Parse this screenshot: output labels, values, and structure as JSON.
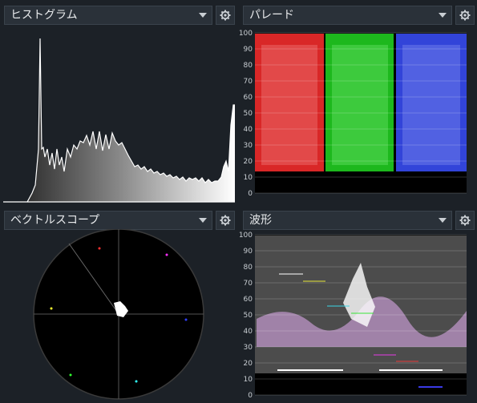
{
  "panels": {
    "histogram": {
      "title": "ヒストグラム",
      "icon": "chevron-down-icon"
    },
    "parade": {
      "title": "パレード",
      "icon": "chevron-down-icon"
    },
    "vectorscope": {
      "title": "ベクトルスコープ",
      "icon": "chevron-down-icon"
    },
    "waveform": {
      "title": "波形",
      "icon": "chevron-down-icon"
    }
  },
  "scale_labels": [
    "100",
    "90",
    "80",
    "70",
    "60",
    "50",
    "40",
    "30",
    "20",
    "10",
    "0"
  ],
  "colors": {
    "bg": "#1c2127",
    "header": "#2a3139",
    "scope_bg": "#000000",
    "red": "#ff3b3b",
    "green": "#2bdc2b",
    "blue": "#4a5cff"
  }
}
